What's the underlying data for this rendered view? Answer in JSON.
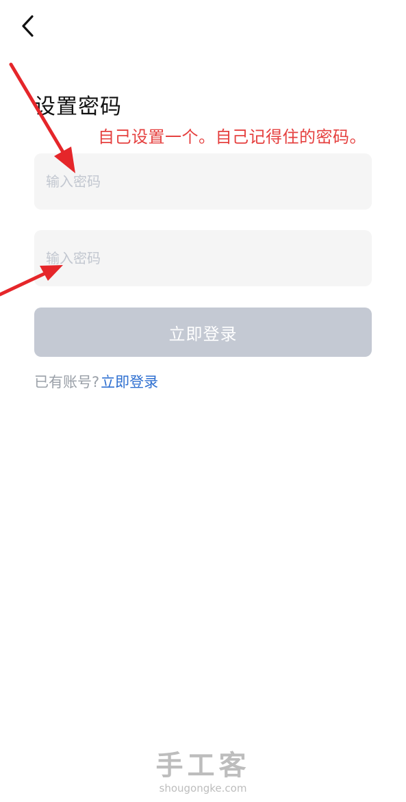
{
  "header": {
    "back_icon": "chevron-left-icon"
  },
  "page": {
    "title": "设置密码",
    "annotation": "自己设置一个。自己记得住的密码。",
    "annotation_color": "#e5403f"
  },
  "form": {
    "password_placeholder": "输入密码",
    "password_value": "",
    "confirm_password_placeholder": "输入密码",
    "confirm_password_value": "",
    "login_button_label": "立即登录",
    "login_button_color": "#c4c9d3"
  },
  "footer": {
    "account_prompt": "已有账号?",
    "login_link": "立即登录",
    "link_color": "#2e6fd0"
  },
  "watermark": {
    "logo_text": "手工客",
    "url_text": "shougongke.com"
  }
}
